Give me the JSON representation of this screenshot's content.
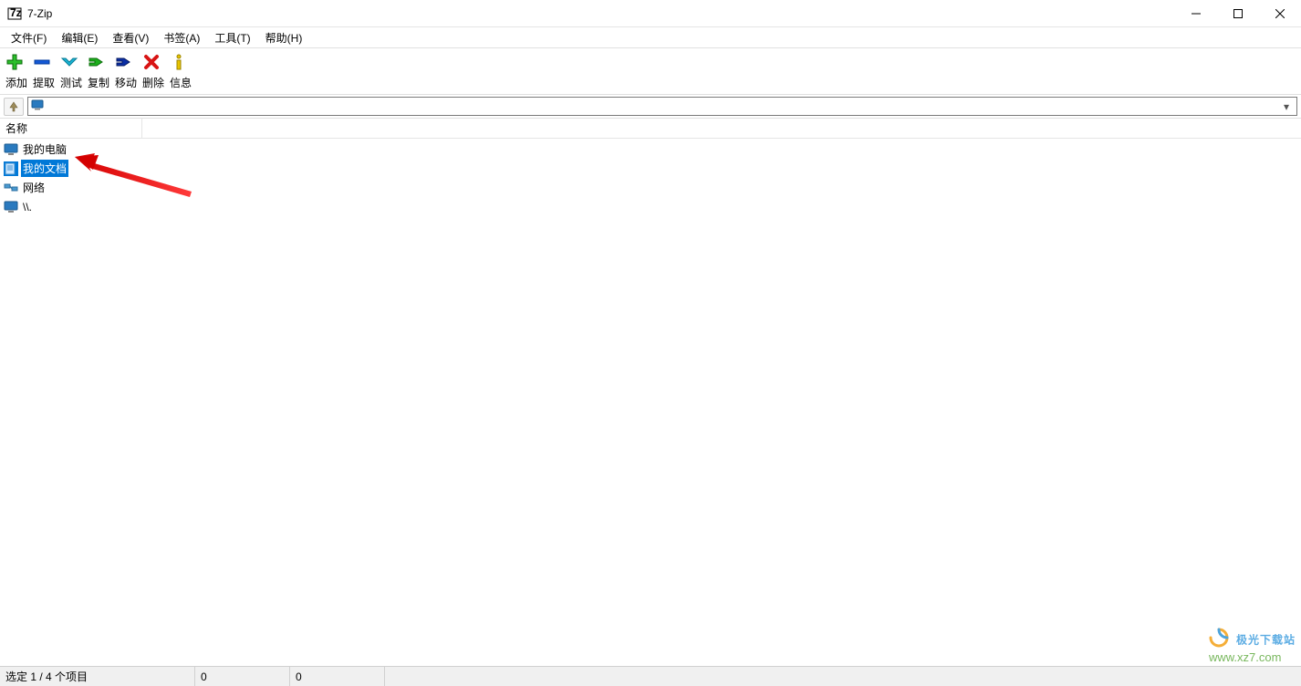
{
  "window": {
    "title": "7-Zip"
  },
  "menubar": {
    "items": [
      {
        "label": "文件(F)"
      },
      {
        "label": "编辑(E)"
      },
      {
        "label": "查看(V)"
      },
      {
        "label": "书签(A)"
      },
      {
        "label": "工具(T)"
      },
      {
        "label": "帮助(H)"
      }
    ]
  },
  "toolbar": {
    "items": [
      {
        "name": "add",
        "label": "添加"
      },
      {
        "name": "extract",
        "label": "提取"
      },
      {
        "name": "test",
        "label": "测试"
      },
      {
        "name": "copy",
        "label": "复制"
      },
      {
        "name": "move",
        "label": "移动"
      },
      {
        "name": "delete",
        "label": "删除"
      },
      {
        "name": "info",
        "label": "信息"
      }
    ]
  },
  "addressbar": {
    "value": ""
  },
  "list": {
    "columns": [
      {
        "name": "name",
        "label": "名称"
      }
    ],
    "rows": [
      {
        "icon": "computer",
        "label": "我的电脑",
        "selected": false
      },
      {
        "icon": "documents",
        "label": "我的文档",
        "selected": true
      },
      {
        "icon": "network",
        "label": "网络",
        "selected": false
      },
      {
        "icon": "computer2",
        "label": "\\\\.",
        "selected": false
      }
    ]
  },
  "statusbar": {
    "selection": "选定 1 / 4 个项目",
    "num1": "0",
    "num2": "0"
  },
  "watermark": {
    "line1": "极光下载站",
    "line2": "www.xz7.com"
  }
}
